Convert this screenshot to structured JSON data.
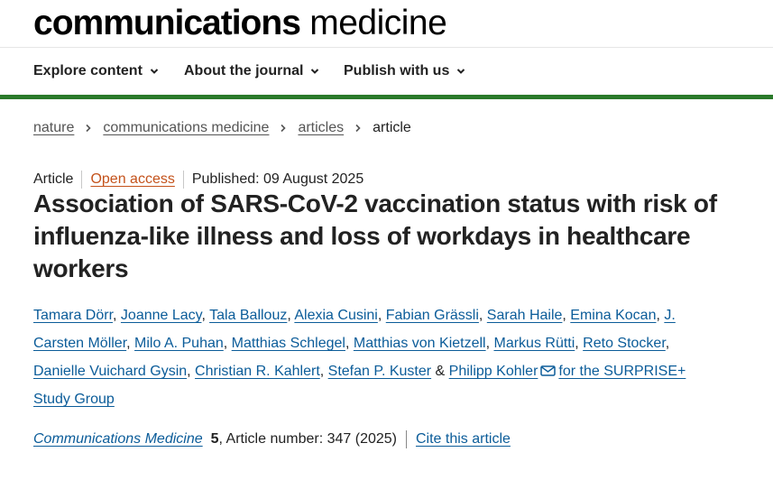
{
  "logo": {
    "bold": "communications",
    "light": " medicine"
  },
  "nav": {
    "items": [
      {
        "label": "Explore content"
      },
      {
        "label": "About the journal"
      },
      {
        "label": "Publish with us"
      }
    ]
  },
  "breadcrumb": {
    "items": [
      "nature",
      "communications medicine",
      "articles"
    ],
    "current": "article"
  },
  "meta": {
    "type": "Article",
    "access": "Open access",
    "published": "Published: 09 August 2025"
  },
  "title": "Association of SARS-CoV-2 vaccination status with risk of influenza-like illness and loss of workdays in healthcare workers",
  "authors": {
    "names": [
      "Tamara Dörr",
      "Joanne Lacy",
      "Tala Ballouz",
      "Alexia Cusini",
      "Fabian Grässli",
      "Sarah Haile",
      "Emina Kocan",
      "J. Carsten Möller",
      "Milo A. Puhan",
      "Matthias Schlegel",
      "Matthias von Kietzell",
      "Markus Rütti",
      "Reto Stocker",
      "Danielle Vuichard Gysin",
      "Christian R. Kahlert",
      "Stefan P. Kuster"
    ],
    "last": "Philipp Kohler",
    "group": "for the SURPRISE+ Study Group",
    "separator": ", ",
    "and": " & "
  },
  "citation": {
    "journal": "Communications Medicine",
    "volume": "5",
    "rest": ", Article number: 347 (2025)",
    "cite_label": "Cite this article"
  },
  "colors": {
    "accent_green": "#2a7a2a",
    "link_blue": "#0b5c99",
    "open_access": "#c4521b"
  },
  "icons": {
    "nav_chevron": "chevron-down-icon",
    "breadcrumb_sep": "chevron-right-icon",
    "corresponding": "envelope-icon"
  }
}
